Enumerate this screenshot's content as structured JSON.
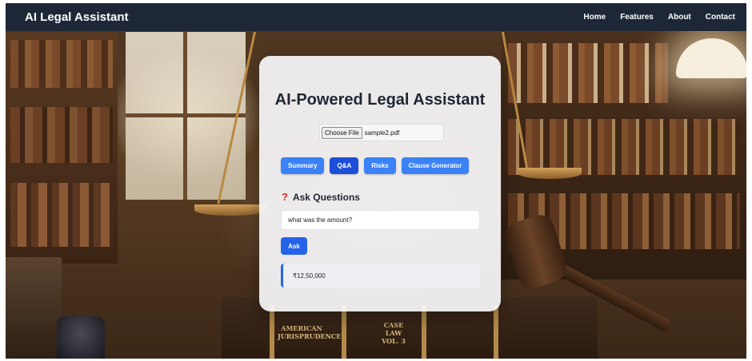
{
  "header": {
    "brand": "AI Legal Assistant",
    "nav": [
      "Home",
      "Features",
      "About",
      "Contact"
    ]
  },
  "card": {
    "title": "AI-Powered Legal Assistant",
    "file_button": "Choose File",
    "file_name": "sample2.pdf",
    "tabs": [
      {
        "label": "Summary",
        "active": false
      },
      {
        "label": "Q&A",
        "active": true
      },
      {
        "label": "Risks",
        "active": false
      },
      {
        "label": "Clause Generator",
        "active": false
      }
    ],
    "section_icon": "question-mark-icon",
    "section_icon_glyph": "?",
    "section_title": "Ask Questions",
    "question_value": "what was the amount?",
    "ask_label": "Ask",
    "answer": "₹12,50,000"
  },
  "background": {
    "book_spines": [
      "AMERICAN JURISPRUDENCE",
      "CASE LAW VOL. 3"
    ]
  },
  "colors": {
    "navbar": "#1d2737",
    "primary_button": "#3b82f6",
    "active_button": "#1d4ed8",
    "question_icon": "#dc2626"
  }
}
